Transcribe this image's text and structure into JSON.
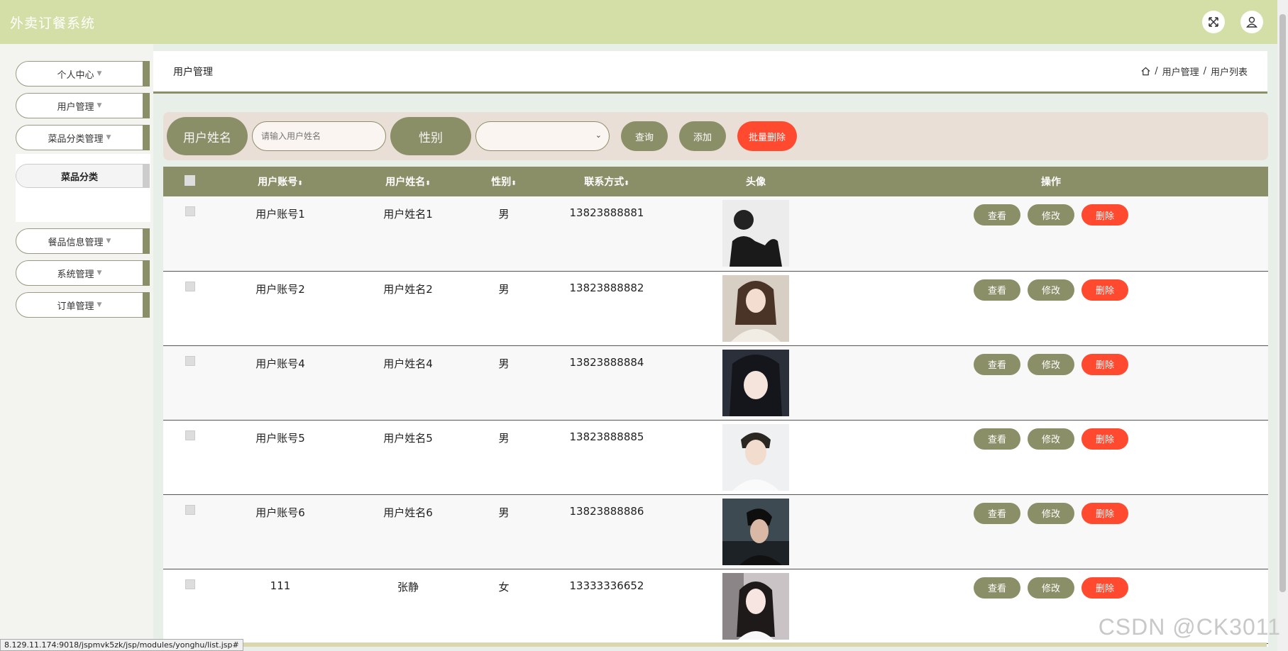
{
  "app": {
    "title": "外卖订餐系统"
  },
  "topbar": {
    "fullscreen_icon": "expand-icon",
    "user_icon": "user-icon"
  },
  "sidebar": {
    "items": [
      {
        "label": "个人中心"
      },
      {
        "label": "用户管理"
      },
      {
        "label": "菜品分类管理"
      },
      {
        "label": "餐品信息管理"
      },
      {
        "label": "系统管理"
      },
      {
        "label": "订单管理"
      }
    ],
    "submenu": {
      "label": "菜品分类"
    }
  },
  "header": {
    "title": "用户管理",
    "breadcrumb": {
      "sep": "/",
      "level1": "用户管理",
      "level2": "用户列表"
    }
  },
  "search": {
    "name_label": "用户姓名",
    "name_placeholder": "请输入用户姓名",
    "gender_label": "性别",
    "gender_value": "",
    "query_button": "查询",
    "add_button": "添加",
    "batch_delete_button": "批量删除"
  },
  "table": {
    "columns": [
      "用户账号",
      "用户姓名",
      "性别",
      "联系方式",
      "头像",
      "操作"
    ],
    "sort_glyph": "⬍",
    "rows": [
      {
        "account": "用户账号1",
        "name": "用户姓名1",
        "gender": "男",
        "phone": "13823888881"
      },
      {
        "account": "用户账号2",
        "name": "用户姓名2",
        "gender": "男",
        "phone": "13823888882"
      },
      {
        "account": "用户账号4",
        "name": "用户姓名4",
        "gender": "男",
        "phone": "13823888884"
      },
      {
        "account": "用户账号5",
        "name": "用户姓名5",
        "gender": "男",
        "phone": "13823888885"
      },
      {
        "account": "用户账号6",
        "name": "用户姓名6",
        "gender": "男",
        "phone": "13823888886"
      },
      {
        "account": "111",
        "name": "张静",
        "gender": "女",
        "phone": "13333336652"
      }
    ],
    "actions": {
      "view": "查看",
      "edit": "修改",
      "delete": "删除"
    }
  },
  "statusbar": {
    "url": "8.129.11.174:9018/jspmvk5zk/jsp/modules/yonghu/list.jsp#"
  },
  "watermark": "CSDN @CK3011",
  "colors": {
    "accent": "#8b8f68",
    "topbar": "#d3dfa6",
    "danger": "#ff4a30"
  }
}
